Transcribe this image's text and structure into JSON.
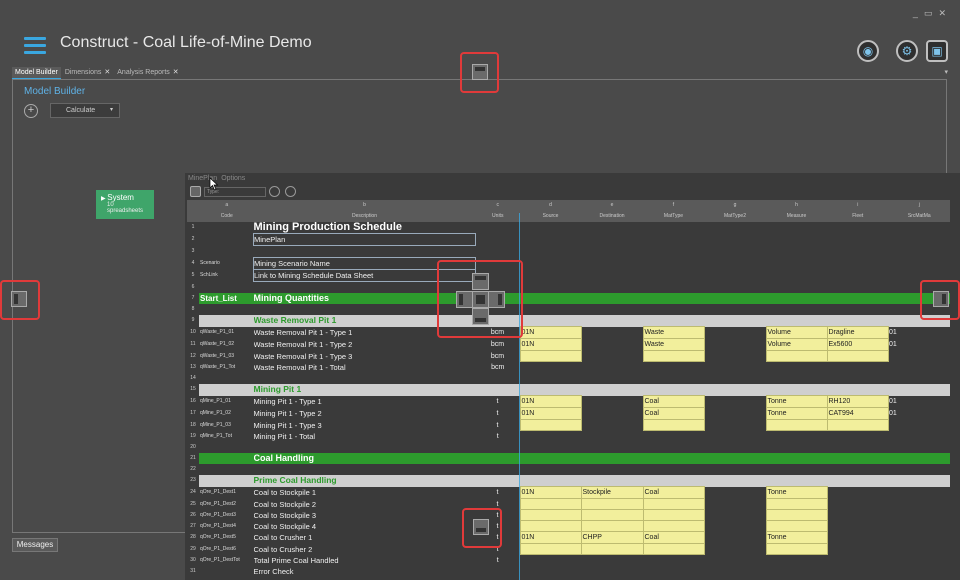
{
  "app": {
    "title": "Construct - Coal Life-of-Mine Demo"
  },
  "window_controls": [
    "_",
    "▭",
    "✕"
  ],
  "tabs": [
    {
      "label": "Model Builder",
      "active": true,
      "closable": false
    },
    {
      "label": "Dimensions",
      "active": false,
      "closable": true
    },
    {
      "label": "Analysis Reports",
      "active": false,
      "closable": true
    }
  ],
  "model_builder": {
    "title": "Model Builder",
    "calculate_label": "Calculate",
    "system_node": {
      "title": "System",
      "subtitle": "10 spreadsheets"
    }
  },
  "messages_label": "Messages",
  "sheet": {
    "tabs": [
      "MinePlan",
      "Options"
    ],
    "type_placeholder": "Type:",
    "col_letters": [
      "a",
      "b",
      "c",
      "d",
      "e",
      "f",
      "g",
      "h",
      "i",
      "j",
      "k",
      "l"
    ],
    "header": [
      "Code",
      "Description",
      "Units",
      "Source",
      "Destination",
      "MatType",
      "MatType2",
      "Measure",
      "Fleet",
      "SrcMatMa"
    ],
    "rows": [
      {
        "n": "1",
        "code": "",
        "desc": "Mining Production Schedule",
        "style": "sheettitle"
      },
      {
        "n": "2",
        "code": "",
        "desc": "MinePlan",
        "style": ""
      },
      {
        "n": "3",
        "code": "",
        "desc": "",
        "style": ""
      },
      {
        "n": "4",
        "code": "Scenario",
        "desc": "Mining Scenario Name",
        "style": ""
      },
      {
        "n": "5",
        "code": "SchLink",
        "desc": "Link to Mining Schedule Data Sheet",
        "style": ""
      },
      {
        "n": "6",
        "code": "",
        "desc": "",
        "style": ""
      },
      {
        "n": "7",
        "code": "Start_List",
        "desc": "Mining Quantities",
        "style": "green"
      },
      {
        "n": "8",
        "code": "",
        "desc": "",
        "style": ""
      },
      {
        "n": "9",
        "code": "",
        "desc": "Waste Removal Pit 1",
        "style": "grey"
      },
      {
        "n": "10",
        "code": "qWaste_P1_01",
        "desc": "Waste Removal Pit 1 - Type 1",
        "units": "bcm",
        "src": "01N",
        "mat": "Waste",
        "meas": "Volume",
        "fleet": "Dragline",
        "extra": "01",
        "style": "data"
      },
      {
        "n": "11",
        "code": "qWaste_P1_02",
        "desc": "Waste Removal Pit 1 - Type 2",
        "units": "bcm",
        "src": "01N",
        "mat": "Waste",
        "meas": "Volume",
        "fleet": "Ex5600",
        "extra": "01",
        "style": "data"
      },
      {
        "n": "12",
        "code": "qWaste_P1_03",
        "desc": "Waste Removal Pit 1 - Type 3",
        "units": "bcm",
        "style": "data"
      },
      {
        "n": "13",
        "code": "qWaste_P1_Tot",
        "desc": "Waste Removal Pit 1 - Total",
        "units": "bcm",
        "style": ""
      },
      {
        "n": "14",
        "code": "",
        "desc": "",
        "style": ""
      },
      {
        "n": "15",
        "code": "",
        "desc": "Mining Pit 1",
        "style": "grey"
      },
      {
        "n": "16",
        "code": "qMine_P1_01",
        "desc": "Mining Pit 1 - Type 1",
        "units": "t",
        "src": "01N",
        "mat": "Coal",
        "meas": "Tonne",
        "fleet": "RH120",
        "extra": "01",
        "style": "data"
      },
      {
        "n": "17",
        "code": "qMine_P1_02",
        "desc": "Mining Pit 1 - Type 2",
        "units": "t",
        "src": "01N",
        "mat": "Coal",
        "meas": "Tonne",
        "fleet": "CAT994",
        "extra": "01",
        "style": "data"
      },
      {
        "n": "18",
        "code": "qMine_P1_03",
        "desc": "Mining Pit 1 - Type 3",
        "units": "t",
        "style": "data"
      },
      {
        "n": "19",
        "code": "qMine_P1_Tot",
        "desc": "Mining Pit 1 - Total",
        "units": "t",
        "style": ""
      },
      {
        "n": "20",
        "code": "",
        "desc": "",
        "style": ""
      },
      {
        "n": "21",
        "code": "",
        "desc": "Coal Handling",
        "style": "green"
      },
      {
        "n": "22",
        "code": "",
        "desc": "",
        "style": ""
      },
      {
        "n": "23",
        "code": "",
        "desc": "Prime Coal Handling",
        "style": "grey"
      },
      {
        "n": "24",
        "code": "qOre_P1_Dest1",
        "desc": "Coal to Stockpile 1",
        "units": "t",
        "src": "01N",
        "dest": "Stockpile",
        "mat": "Coal",
        "meas": "Tonne",
        "style": "data2"
      },
      {
        "n": "25",
        "code": "qOre_P1_Dest2",
        "desc": "Coal to Stockpile 2",
        "units": "t",
        "style": "data2"
      },
      {
        "n": "26",
        "code": "qOre_P1_Dest3",
        "desc": "Coal to Stockpile 3",
        "units": "t",
        "style": "data2"
      },
      {
        "n": "27",
        "code": "qOre_P1_Dest4",
        "desc": "Coal to Stockpile 4",
        "units": "t",
        "style": "data2"
      },
      {
        "n": "28",
        "code": "qOre_P1_Dest5",
        "desc": "Coal to Crusher 1",
        "units": "t",
        "src": "01N",
        "dest": "CHPP",
        "mat": "Coal",
        "meas": "Tonne",
        "style": "data2"
      },
      {
        "n": "29",
        "code": "qOre_P1_Dest6",
        "desc": "Coal to Crusher 2",
        "units": "t",
        "style": "data2"
      },
      {
        "n": "30",
        "code": "qOre_P1_DestTot",
        "desc": "Total Prime Coal Handled",
        "units": "t",
        "style": ""
      },
      {
        "n": "31",
        "code": "",
        "desc": "Error Check",
        "style": ""
      }
    ]
  },
  "colors": {
    "accent": "#3aa7e0",
    "section_green": "#2d9b2d",
    "input_yellow": "#f2ef9c",
    "highlight_red": "#e03a3a"
  },
  "icons": [
    "menu-icon",
    "globe-icon",
    "settings-icon",
    "save-icon",
    "dock-indicator-icon"
  ]
}
